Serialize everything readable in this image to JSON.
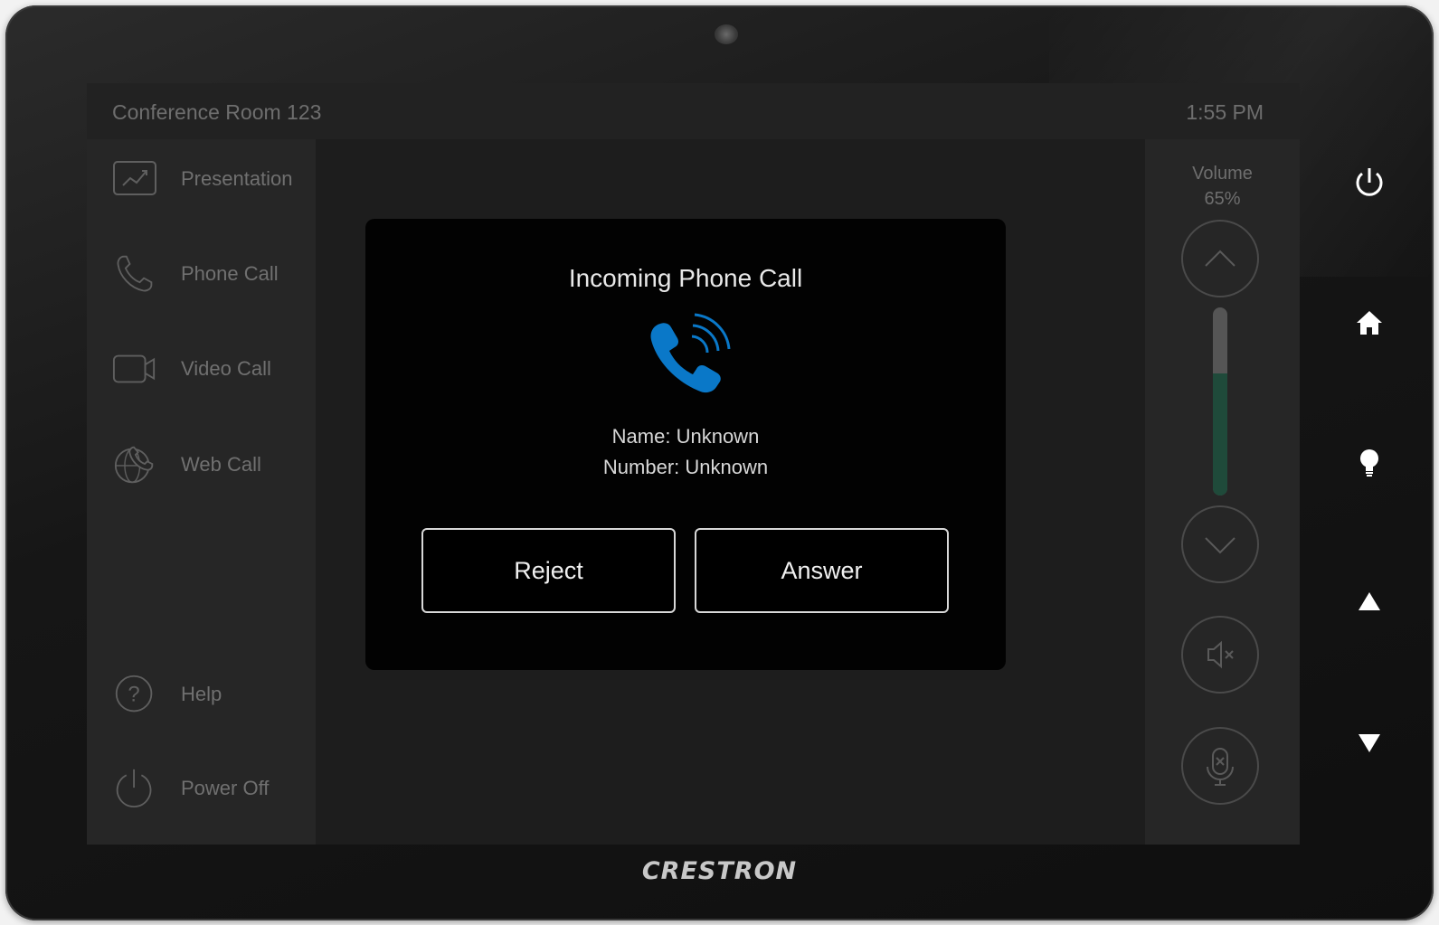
{
  "header": {
    "room": "Conference Room 123",
    "time": "1:55 PM"
  },
  "sidebar": {
    "items": [
      {
        "label": "Presentation",
        "icon": "presentation-icon"
      },
      {
        "label": "Phone Call",
        "icon": "phone-icon"
      },
      {
        "label": "Video Call",
        "icon": "video-camera-icon"
      },
      {
        "label": "Web Call",
        "icon": "globe-phone-icon"
      }
    ],
    "bottom": [
      {
        "label": "Help",
        "icon": "help-icon"
      },
      {
        "label": "Power Off",
        "icon": "power-icon"
      }
    ]
  },
  "volume": {
    "label": "Volume",
    "percent_text": "65%",
    "level": 0.65
  },
  "dialog": {
    "title": "Incoming Phone Call",
    "name_line": "Name: Unknown",
    "number_line": "Number: Unknown",
    "reject_label": "Reject",
    "answer_label": "Answer"
  },
  "hardware_buttons": [
    "power-icon",
    "home-icon",
    "lightbulb-icon",
    "triangle-up-icon",
    "triangle-down-icon"
  ],
  "brand": "CRESTRON",
  "colors": {
    "accent": "#0a78c8",
    "volume_fill": "#1f4a3a",
    "screen_bg": "#232323"
  }
}
